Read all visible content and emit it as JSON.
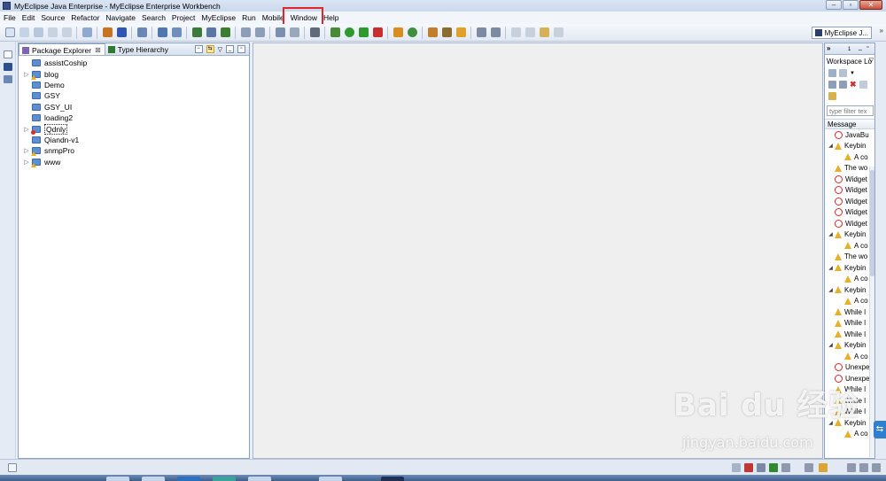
{
  "window": {
    "title": "MyEclipse Java Enterprise - MyEclipse Enterprise Workbench"
  },
  "menu": [
    "File",
    "Edit",
    "Source",
    "Refactor",
    "Navigate",
    "Search",
    "Project",
    "MyEclipse",
    "Run",
    "Mobile",
    "Window",
    "Help"
  ],
  "toolbar": {
    "perspective_label": "MyEclipse J..."
  },
  "package_explorer": {
    "tab_label": "Package Explorer",
    "tab_close": "⊠",
    "second_tab_label": "Type Hierarchy",
    "projects": [
      {
        "name": "assistCoship",
        "expandable": false,
        "marker": ""
      },
      {
        "name": "blog",
        "expandable": true,
        "marker": "warn"
      },
      {
        "name": "Demo",
        "expandable": false,
        "marker": ""
      },
      {
        "name": "GSY",
        "expandable": false,
        "marker": ""
      },
      {
        "name": "GSY_UI",
        "expandable": false,
        "marker": ""
      },
      {
        "name": "loading2",
        "expandable": false,
        "marker": ""
      },
      {
        "name": "Qdnly",
        "expandable": true,
        "marker": "err"
      },
      {
        "name": "Qiandn-v1",
        "expandable": false,
        "marker": ""
      },
      {
        "name": "snmpPro",
        "expandable": true,
        "marker": "warn"
      },
      {
        "name": "www",
        "expandable": true,
        "marker": "warn"
      }
    ]
  },
  "problems_view": {
    "tab_more": "»",
    "tab_count": "1",
    "title": "Workspace Lo",
    "filter_placeholder": "type filter tex",
    "column_header": "Message",
    "messages": [
      {
        "level": "error",
        "indent": 1,
        "expander": "",
        "text": "JavaBu"
      },
      {
        "level": "warn",
        "indent": 0,
        "expander": "◢",
        "text": "Keybin"
      },
      {
        "level": "warn",
        "indent": 2,
        "expander": "",
        "text": "A co"
      },
      {
        "level": "warn",
        "indent": 1,
        "expander": "",
        "text": "The wo"
      },
      {
        "level": "error",
        "indent": 1,
        "expander": "",
        "text": "Widget"
      },
      {
        "level": "error",
        "indent": 1,
        "expander": "",
        "text": "Widget"
      },
      {
        "level": "error",
        "indent": 1,
        "expander": "",
        "text": "Widget"
      },
      {
        "level": "error",
        "indent": 1,
        "expander": "",
        "text": "Widget"
      },
      {
        "level": "error",
        "indent": 1,
        "expander": "",
        "text": "Widget"
      },
      {
        "level": "warn",
        "indent": 0,
        "expander": "◢",
        "text": "Keybin"
      },
      {
        "level": "warn",
        "indent": 2,
        "expander": "",
        "text": "A co"
      },
      {
        "level": "warn",
        "indent": 1,
        "expander": "",
        "text": "The wo"
      },
      {
        "level": "warn",
        "indent": 0,
        "expander": "◢",
        "text": "Keybin"
      },
      {
        "level": "warn",
        "indent": 2,
        "expander": "",
        "text": "A co"
      },
      {
        "level": "warn",
        "indent": 0,
        "expander": "◢",
        "text": "Keybin"
      },
      {
        "level": "warn",
        "indent": 2,
        "expander": "",
        "text": "A co"
      },
      {
        "level": "warn",
        "indent": 1,
        "expander": "",
        "text": "While l"
      },
      {
        "level": "warn",
        "indent": 1,
        "expander": "",
        "text": "While l"
      },
      {
        "level": "warn",
        "indent": 1,
        "expander": "",
        "text": "While l"
      },
      {
        "level": "warn",
        "indent": 0,
        "expander": "◢",
        "text": "Keybin"
      },
      {
        "level": "warn",
        "indent": 2,
        "expander": "",
        "text": "A co"
      },
      {
        "level": "error",
        "indent": 1,
        "expander": "",
        "text": "Unexpe"
      },
      {
        "level": "error",
        "indent": 1,
        "expander": "",
        "text": "Unexpe"
      },
      {
        "level": "warn",
        "indent": 1,
        "expander": "",
        "text": "While l"
      },
      {
        "level": "warn",
        "indent": 1,
        "expander": "",
        "text": "While l"
      },
      {
        "level": "warn",
        "indent": 1,
        "expander": "",
        "text": "While l"
      },
      {
        "level": "warn",
        "indent": 0,
        "expander": "◢",
        "text": "Keybin"
      },
      {
        "level": "warn",
        "indent": 2,
        "expander": "",
        "text": "A co"
      }
    ]
  },
  "watermark": {
    "logo": "Bai du 经验",
    "sub": "jingyan.baidu.com"
  },
  "colors": {
    "highlight": "#e1262a",
    "folder": "#5e8fd0",
    "error": "#d22b2b",
    "warning": "#e6b12a"
  }
}
